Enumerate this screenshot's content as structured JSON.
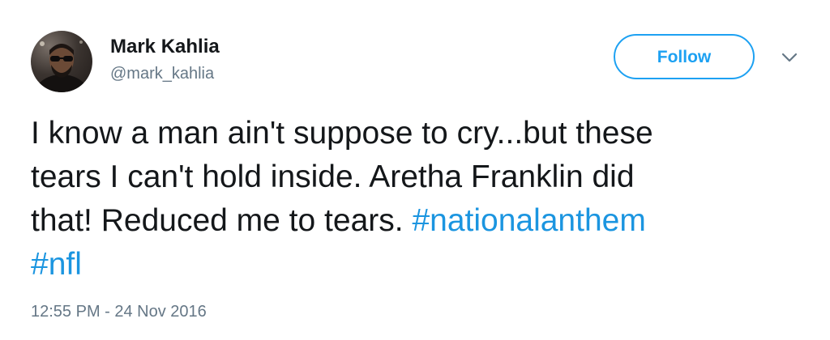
{
  "author": {
    "display_name": "Mark Kahlia",
    "handle": "@mark_kahlia",
    "avatar_icon": "profile-photo"
  },
  "actions": {
    "follow_label": "Follow",
    "menu_icon": "chevron-down-icon"
  },
  "tweet": {
    "line1": "I know a man ain't suppose to cry...but these",
    "line2": "tears I can't hold inside. Aretha Franklin did",
    "line3": "that! Reduced me to tears.",
    "hashtags": [
      "#nationalanthem",
      "#nfl"
    ],
    "timestamp": "12:55 PM - 24 Nov 2016"
  },
  "colors": {
    "accent": "#1da1f2",
    "hashtag": "#1b95e0",
    "secondary_text": "#657786",
    "primary_text": "#14171a"
  }
}
